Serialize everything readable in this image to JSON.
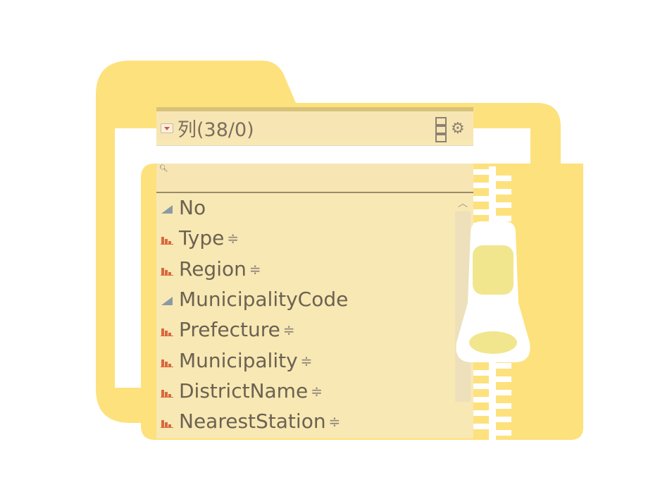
{
  "panel": {
    "title": "列(38/0)",
    "search": {
      "placeholder": ""
    },
    "columns": [
      {
        "name": "No",
        "type": "continuous",
        "sort_icon": false
      },
      {
        "name": "Type",
        "type": "nominal",
        "sort_icon": true
      },
      {
        "name": "Region",
        "type": "nominal",
        "sort_icon": true
      },
      {
        "name": "MunicipalityCode",
        "type": "continuous",
        "sort_icon": false
      },
      {
        "name": "Prefecture",
        "type": "nominal",
        "sort_icon": true
      },
      {
        "name": "Municipality",
        "type": "nominal",
        "sort_icon": true
      },
      {
        "name": "DistrictName",
        "type": "nominal",
        "sort_icon": true
      },
      {
        "name": "NearestStation",
        "type": "nominal",
        "sort_icon": true
      }
    ]
  },
  "icons": {
    "collapse": "collapse-triangle-icon",
    "layout": "column-layout-icon",
    "settings": "gear-icon",
    "search": "magnifier-icon",
    "continuous": "continuous-triangle-icon",
    "nominal": "nominal-bars-icon",
    "sort": "sort-updown-icon"
  },
  "colors": {
    "folder": "#fde17c",
    "panel": "#f8e8b4",
    "text": "#6b6251",
    "nominal_icon": "#d9683f",
    "continuous_icon": "#8a9aa5",
    "zipper_body": "#ffffff",
    "zipper_pull": "#f1e68e"
  }
}
